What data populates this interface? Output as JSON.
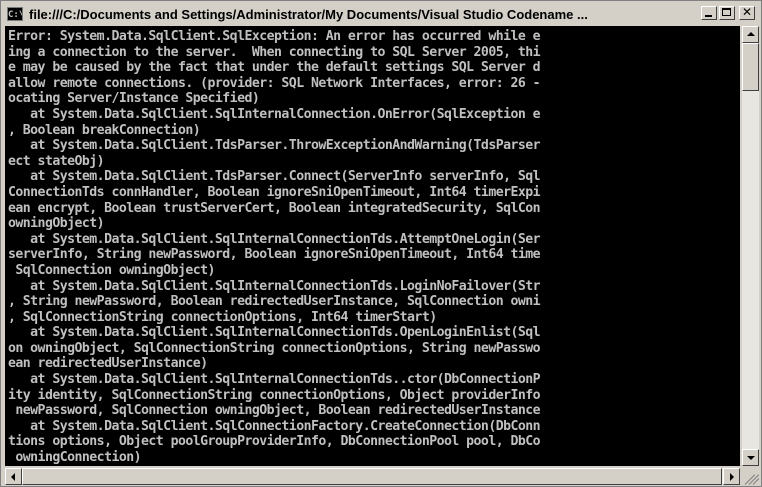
{
  "window": {
    "title": "file:///C:/Documents and Settings/Administrator/My Documents/Visual Studio Codename ...",
    "icon_text": "C:\\"
  },
  "controls": {
    "minimize": "minimize-icon",
    "maximize": "maximize-icon",
    "close": "close-icon",
    "close_glyph": "✕"
  },
  "console": {
    "colors": {
      "background": "#000000",
      "text": "#c0c0c0"
    },
    "lines": [
      "Error: System.Data.SqlClient.SqlException: An error has occurred while e",
      "ing a connection to the server.  When connecting to SQL Server 2005, thi",
      "e may be caused by the fact that under the default settings SQL Server d",
      "allow remote connections. (provider: SQL Network Interfaces, error: 26 -",
      "ocating Server/Instance Specified)",
      "   at System.Data.SqlClient.SqlInternalConnection.OnError(SqlException e",
      ", Boolean breakConnection)",
      "   at System.Data.SqlClient.TdsParser.ThrowExceptionAndWarning(TdsParser",
      "ect stateObj)",
      "   at System.Data.SqlClient.TdsParser.Connect(ServerInfo serverInfo, Sql",
      "ConnectionTds connHandler, Boolean ignoreSniOpenTimeout, Int64 timerExpi",
      "ean encrypt, Boolean trustServerCert, Boolean integratedSecurity, SqlCon",
      "owningObject)",
      "   at System.Data.SqlClient.SqlInternalConnectionTds.AttemptOneLogin(Ser",
      "serverInfo, String newPassword, Boolean ignoreSniOpenTimeout, Int64 time",
      " SqlConnection owningObject)",
      "   at System.Data.SqlClient.SqlInternalConnectionTds.LoginNoFailover(Str",
      ", String newPassword, Boolean redirectedUserInstance, SqlConnection owni",
      ", SqlConnectionString connectionOptions, Int64 timerStart)",
      "   at System.Data.SqlClient.SqlInternalConnectionTds.OpenLoginEnlist(Sql",
      "on owningObject, SqlConnectionString connectionOptions, String newPasswo",
      "ean redirectedUserInstance)",
      "   at System.Data.SqlClient.SqlInternalConnectionTds..ctor(DbConnectionP",
      "ity identity, SqlConnectionString connectionOptions, Object providerInfo",
      " newPassword, SqlConnection owningObject, Boolean redirectedUserInstance",
      "   at System.Data.SqlClient.SqlConnectionFactory.CreateConnection(DbConn",
      "tions options, Object poolGroupProviderInfo, DbConnectionPool pool, DbCo",
      " owningConnection)"
    ]
  },
  "scrollbars": {
    "vertical_position": 0,
    "horizontal_position": 0
  }
}
